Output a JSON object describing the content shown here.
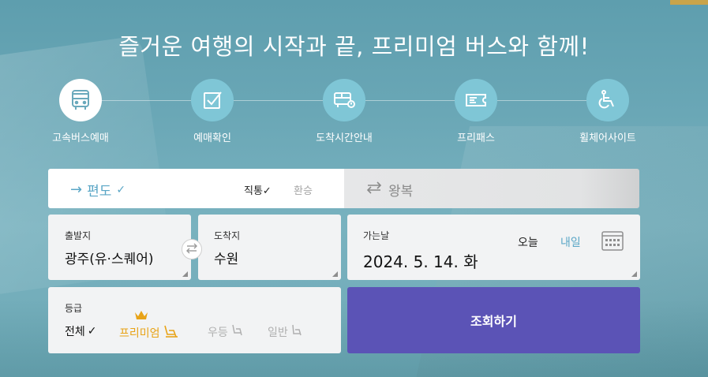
{
  "headline": "즐거운 여행의 시작과 끝, 프리미엄 버스와 함께!",
  "menu": [
    {
      "label": "고속버스예매",
      "icon": "bus-icon",
      "active": true
    },
    {
      "label": "예매확인",
      "icon": "check-square-icon",
      "active": false
    },
    {
      "label": "도착시간안내",
      "icon": "bus-clock-icon",
      "active": false
    },
    {
      "label": "프리패스",
      "icon": "ticket-icon",
      "active": false
    },
    {
      "label": "휠체어사이트",
      "icon": "wheelchair-icon",
      "active": false
    }
  ],
  "trip": {
    "oneway_label": "편도",
    "oneway_check": "✓",
    "direct_label": "직통",
    "direct_check": "✓",
    "transfer_label": "환승",
    "return_label": "왕복"
  },
  "departure": {
    "label": "출발지",
    "value": "광주(유·스퀘어)"
  },
  "arrival": {
    "label": "도착지",
    "value": "수원"
  },
  "date": {
    "label": "가는날",
    "value": "2024. 5. 14. 화",
    "today": "오늘",
    "tomorrow": "내일"
  },
  "grade": {
    "label": "등급",
    "all": "전체",
    "all_check": "✓",
    "premium": "프리미엄",
    "superior": "우등",
    "standard": "일반"
  },
  "search_button": "조회하기",
  "colors": {
    "accent": "#5aa6c6",
    "button": "#5b53b6",
    "premium": "#e8a317",
    "icon_circle": "#7fc6d6"
  }
}
